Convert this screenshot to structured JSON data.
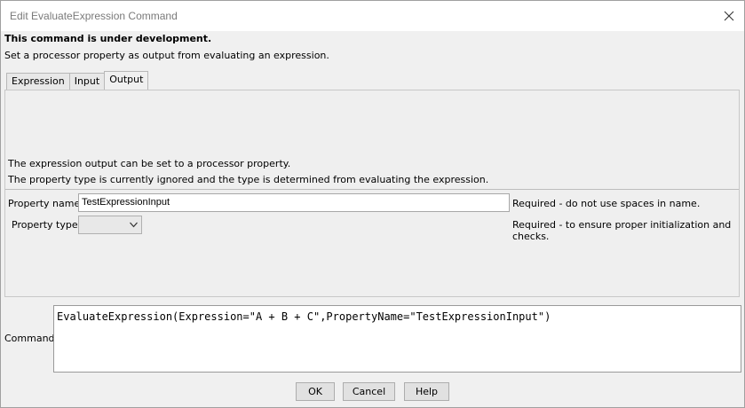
{
  "window": {
    "title": "Edit EvaluateExpression Command"
  },
  "header": {
    "dev_note": "This command is under development.",
    "description": "Set a processor property as output from evaluating an expression."
  },
  "tabs": [
    {
      "label": "Expression",
      "active": false
    },
    {
      "label": "Input",
      "active": false
    },
    {
      "label": "Output",
      "active": true
    }
  ],
  "output_panel": {
    "info_line1": "The expression output can be set to a processor property.",
    "info_line2": "The property type is currently ignored and the type is determined from evaluating the expression.",
    "property_name": {
      "label": "Property name:",
      "value": "TestExpressionInput",
      "note": "Required - do not use spaces in name."
    },
    "property_type": {
      "label": "Property type:",
      "value": "",
      "note": "Required - to ensure proper initialization and checks."
    }
  },
  "command": {
    "label": "Command:",
    "text": "EvaluateExpression(Expression=\"A + B + C\",PropertyName=\"TestExpressionInput\")"
  },
  "buttons": {
    "ok": "OK",
    "cancel": "Cancel",
    "help": "Help"
  }
}
